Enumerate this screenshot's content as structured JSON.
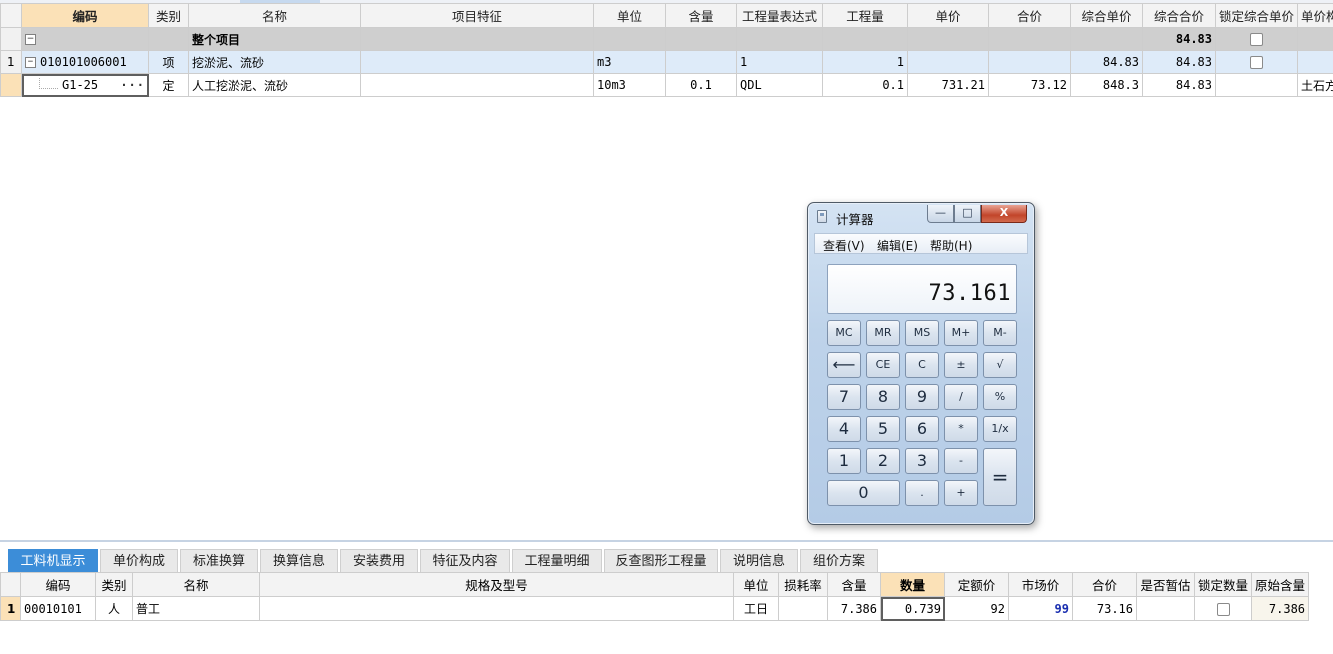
{
  "main_table": {
    "headers": [
      "编码",
      "类别",
      "名称",
      "项目特征",
      "单位",
      "含量",
      "工程量表达式",
      "工程量",
      "单价",
      "合价",
      "综合单价",
      "综合合价",
      "锁定综合单价",
      "单价构成文件"
    ],
    "group_row": {
      "name": "整个项目",
      "total": "84.83"
    },
    "item_row": {
      "row_num": "1",
      "code": "010101006001",
      "type": "项",
      "name": "挖淤泥、流砂",
      "unit": "m3",
      "expression": "1",
      "quantity": "1",
      "comp_price": "84.83",
      "comp_total": "84.83"
    },
    "sub_row": {
      "code": "G1-25",
      "type": "定",
      "name": "人工挖淤泥、流砂",
      "unit": "10m3",
      "content": "0.1",
      "expression": "QDL",
      "quantity": "0.1",
      "price": "731.21",
      "total": "73.12",
      "comp_price": "848.3",
      "comp_total": "84.83",
      "file": "土石方工程"
    }
  },
  "bottom_tabs": [
    "工料机显示",
    "单价构成",
    "标准换算",
    "换算信息",
    "安装费用",
    "特征及内容",
    "工程量明细",
    "反查图形工程量",
    "说明信息",
    "组价方案"
  ],
  "sub_table": {
    "headers": [
      "编码",
      "类别",
      "名称",
      "规格及型号",
      "单位",
      "损耗率",
      "含量",
      "数量",
      "定额价",
      "市场价",
      "合价",
      "是否暂估",
      "锁定数量",
      "原始含量"
    ],
    "row": {
      "row_num": "1",
      "code": "00010101",
      "type": "人",
      "name": "普工",
      "unit": "工日",
      "content": "7.386",
      "quantity": "0.739",
      "fixed_price": "92",
      "market_price": "99",
      "total": "73.16",
      "orig_content": "7.386"
    }
  },
  "calculator": {
    "title": "计算器",
    "window_buttons": {
      "minimize": "—",
      "maximize": "□",
      "close": "X"
    },
    "menu": [
      "查看(V)",
      "编辑(E)",
      "帮助(H)"
    ],
    "display": "73.161",
    "buttons": {
      "mc": "MC",
      "mr": "MR",
      "ms": "MS",
      "mplus": "M+",
      "mminus": "M-",
      "back": "⟵",
      "ce": "CE",
      "c": "C",
      "plusminus": "±",
      "sqrt": "√",
      "n7": "7",
      "n8": "8",
      "n9": "9",
      "div": "/",
      "pct": "%",
      "n4": "4",
      "n5": "5",
      "n6": "6",
      "mul": "*",
      "recip": "1/x",
      "n1": "1",
      "n2": "2",
      "n3": "3",
      "sub": "-",
      "eq": "=",
      "n0": "0",
      "dot": ".",
      "add": "+"
    }
  }
}
